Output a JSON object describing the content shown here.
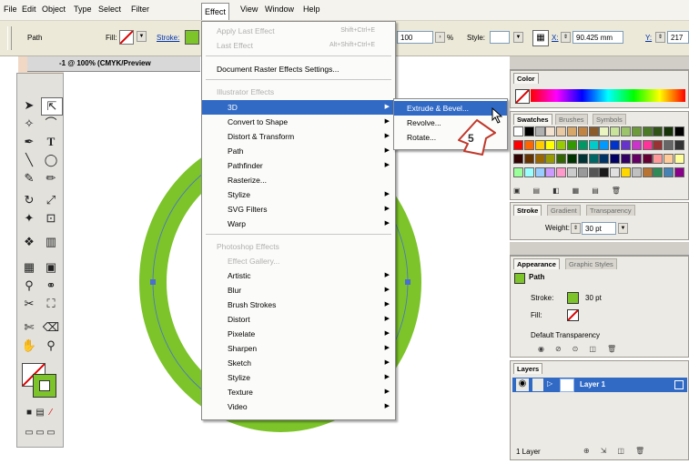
{
  "menubar": {
    "items": [
      "File",
      "Edit",
      "Object",
      "Type",
      "Select",
      "Filter",
      "Effect",
      "View",
      "Window",
      "Help"
    ],
    "active_index": 6
  },
  "control_bar": {
    "object_label": "Path",
    "fill_label": "Fill:",
    "stroke_label": "Stroke:",
    "opacity_value": "100",
    "opacity_unit": "%",
    "style_label": "Style:",
    "x_label": "X:",
    "x_value": "90.425 mm",
    "y_label": "Y:",
    "y_value": "217"
  },
  "document_tab": {
    "title": "-1 @ 100% (CMYK/Preview"
  },
  "effect_menu": {
    "apply_last": "Apply Last Effect",
    "apply_last_shortcut": "Shift+Ctrl+E",
    "last_effect": "Last Effect",
    "last_effect_shortcut": "Alt+Shift+Ctrl+E",
    "doc_raster": "Document Raster Effects Settings...",
    "illustrator_header": "Illustrator Effects",
    "illustrator_items": [
      "3D",
      "Convert to Shape",
      "Distort & Transform",
      "Path",
      "Pathfinder",
      "Rasterize...",
      "Stylize",
      "SVG Filters",
      "Warp"
    ],
    "photoshop_header": "Photoshop Effects",
    "effect_gallery": "Effect Gallery...",
    "photoshop_items": [
      "Artistic",
      "Blur",
      "Brush Strokes",
      "Distort",
      "Pixelate",
      "Sharpen",
      "Sketch",
      "Stylize",
      "Texture",
      "Video"
    ]
  },
  "submenu_3d": {
    "items": [
      "Extrude & Bevel...",
      "Revolve...",
      "Rotate..."
    ],
    "highlight_index": 0
  },
  "callout": {
    "step": "5"
  },
  "color_panel": {
    "tab": "Color"
  },
  "swatches_panel": {
    "tabs": [
      "Swatches",
      "Brushes",
      "Symbols"
    ]
  },
  "stroke_panel": {
    "tabs": [
      "Stroke",
      "Gradient",
      "Transparency"
    ],
    "weight_label": "Weight:",
    "weight_value": "30 pt"
  },
  "appearance_panel": {
    "tabs": [
      "Appearance",
      "Graphic Styles"
    ],
    "object": "Path",
    "stroke_label": "Stroke:",
    "stroke_value": "30 pt",
    "fill_label": "Fill:",
    "transparency": "Default Transparency"
  },
  "layers_panel": {
    "tab": "Layers",
    "layer_name": "Layer 1",
    "footer": "1 Layer"
  },
  "colors": {
    "ring": "#7cc42a",
    "menu_highlight": "#316ac5",
    "callout_stroke": "#c0392b"
  }
}
